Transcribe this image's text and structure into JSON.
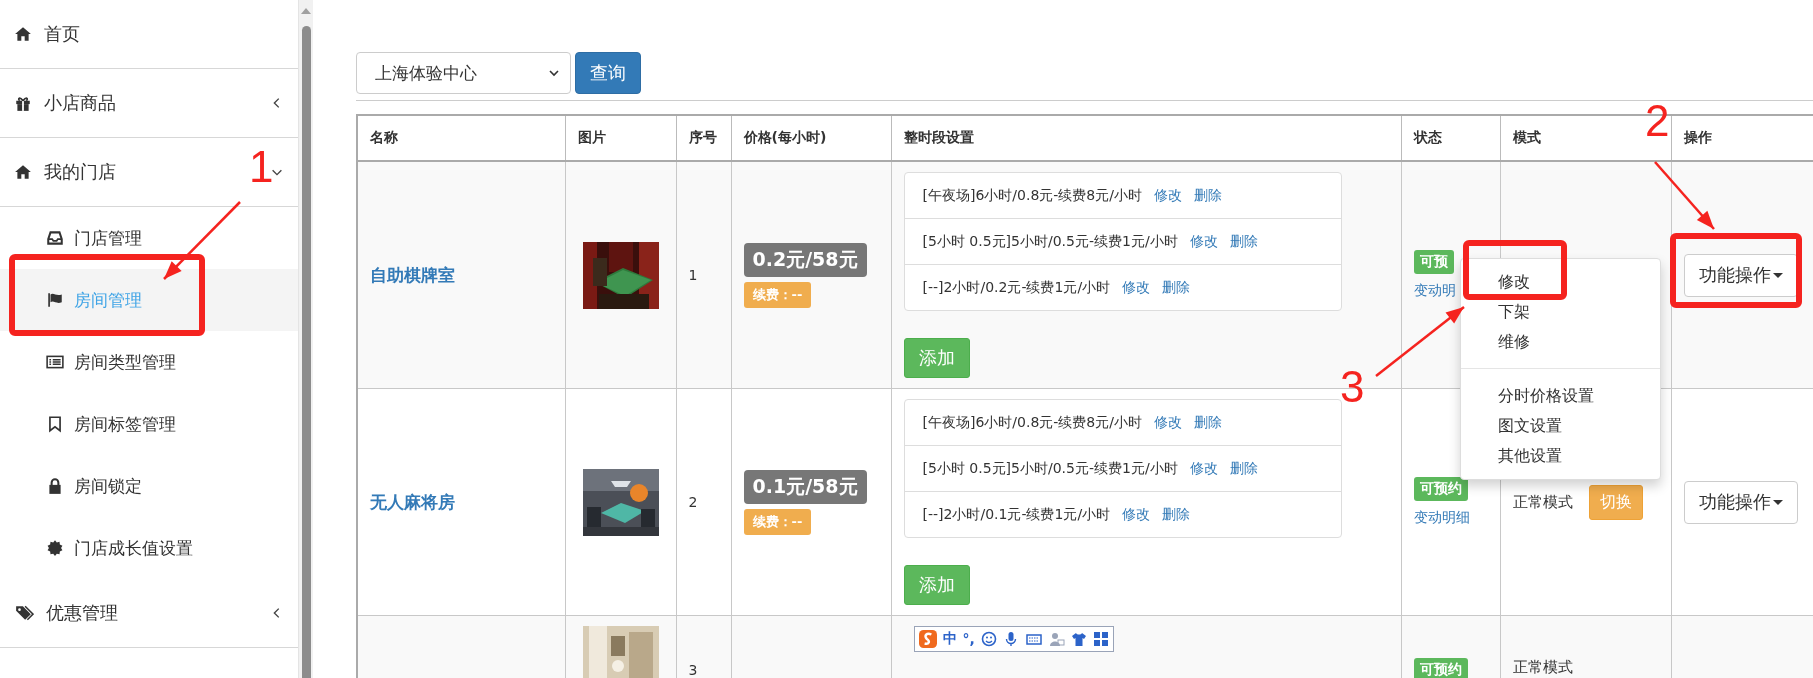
{
  "sidebar": {
    "items": [
      {
        "label": "首页"
      },
      {
        "label": "小店商品",
        "expanded": false
      },
      {
        "label": "我的门店",
        "expanded": true,
        "children": [
          {
            "label": "门店管理",
            "selected": false
          },
          {
            "label": "房间管理",
            "selected": true
          },
          {
            "label": "房间类型管理",
            "selected": false
          },
          {
            "label": "房间标签管理",
            "selected": false
          },
          {
            "label": "房间锁定",
            "selected": false
          },
          {
            "label": "门店成长值设置",
            "selected": false
          }
        ]
      },
      {
        "label": "优惠管理",
        "expanded": false
      }
    ]
  },
  "filter": {
    "store_select": "上海体验中心",
    "query_button": "查询"
  },
  "table": {
    "columns": [
      "名称",
      "图片",
      "序号",
      "价格(每小时)",
      "整时段设置",
      "状态",
      "模式",
      "操作"
    ],
    "rows": [
      {
        "name": "自助棋牌室",
        "image": {
          "kind": "picture"
        },
        "index": "1",
        "price": "0.2元/58元",
        "renewal": "续费：--",
        "periods": [
          {
            "text": "[午夜场]6小时/0.8元-续费8元/小时",
            "edit": "修改",
            "delete": "删除"
          },
          {
            "text": "[5小时 0.5元]5小时/0.5元-续费1元/小时",
            "edit": "修改",
            "delete": "删除"
          },
          {
            "text": "[--]2小时/0.2元-续费1元/小时",
            "edit": "修改",
            "delete": "删除"
          }
        ],
        "add": "添加",
        "status": "可预",
        "status_link": "变动明",
        "action": "功能操作"
      },
      {
        "name": "无人麻将房",
        "image": {
          "kind": "picture"
        },
        "index": "2",
        "price": "0.1元/58元",
        "renewal": "续费：--",
        "periods": [
          {
            "text": "[午夜场]6小时/0.8元-续费8元/小时",
            "edit": "修改",
            "delete": "删除"
          },
          {
            "text": "[5小时 0.5元]5小时/0.5元-续费1元/小时",
            "edit": "修改",
            "delete": "删除"
          },
          {
            "text": "[--]2小时/0.1元-续费1元/小时",
            "edit": "修改",
            "delete": "删除"
          }
        ],
        "add": "添加",
        "status": "可预约",
        "status_link": "变动明细",
        "mode": "正常模式",
        "switch": "切换",
        "action": "功能操作"
      },
      {
        "image": {
          "kind": "picture"
        },
        "index": "3",
        "ime_toolbar": {
          "labels": [
            "中",
            "°,"
          ]
        },
        "status": "可预约",
        "mode": "正常模式"
      }
    ]
  },
  "action_menu": {
    "items": [
      {
        "kind": "item",
        "label": "修改"
      },
      {
        "kind": "item",
        "label": "下架"
      },
      {
        "kind": "item",
        "label": "维修"
      },
      {
        "kind": "divider"
      },
      {
        "kind": "item",
        "label": "分时价格设置"
      },
      {
        "kind": "item",
        "label": "图文设置"
      },
      {
        "kind": "item",
        "label": "其他设置"
      }
    ]
  },
  "annotations": [
    {
      "number": "1"
    },
    {
      "number": "2"
    },
    {
      "number": "3"
    }
  ]
}
